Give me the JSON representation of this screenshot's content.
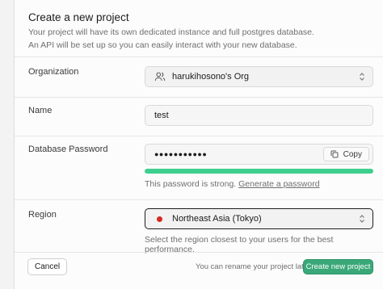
{
  "dialog": {
    "title": "Create a new project",
    "description_line1": "Your project will have its own dedicated instance and full postgres database.",
    "description_line2": "An API will be set up so you can easily interact with your new database."
  },
  "organization": {
    "label": "Organization",
    "value": "harukihosono's Org",
    "icon": "people-icon"
  },
  "name": {
    "label": "Name",
    "value": "test"
  },
  "password": {
    "label": "Database Password",
    "value": "●●●●●●●●●●●",
    "copy_label": "Copy",
    "strength_text": "This password is strong.",
    "generate_link": "Generate a password",
    "strength_fraction": 1.0,
    "strength_color": "#3ecf8e"
  },
  "region": {
    "label": "Region",
    "value": "Northeast Asia (Tokyo)",
    "flag_color": "#d52b1e",
    "hint": "Select the region closest to your users for the best performance."
  },
  "footer": {
    "cancel_label": "Cancel",
    "note": "You can rename your project later",
    "create_label": "Create new project"
  }
}
